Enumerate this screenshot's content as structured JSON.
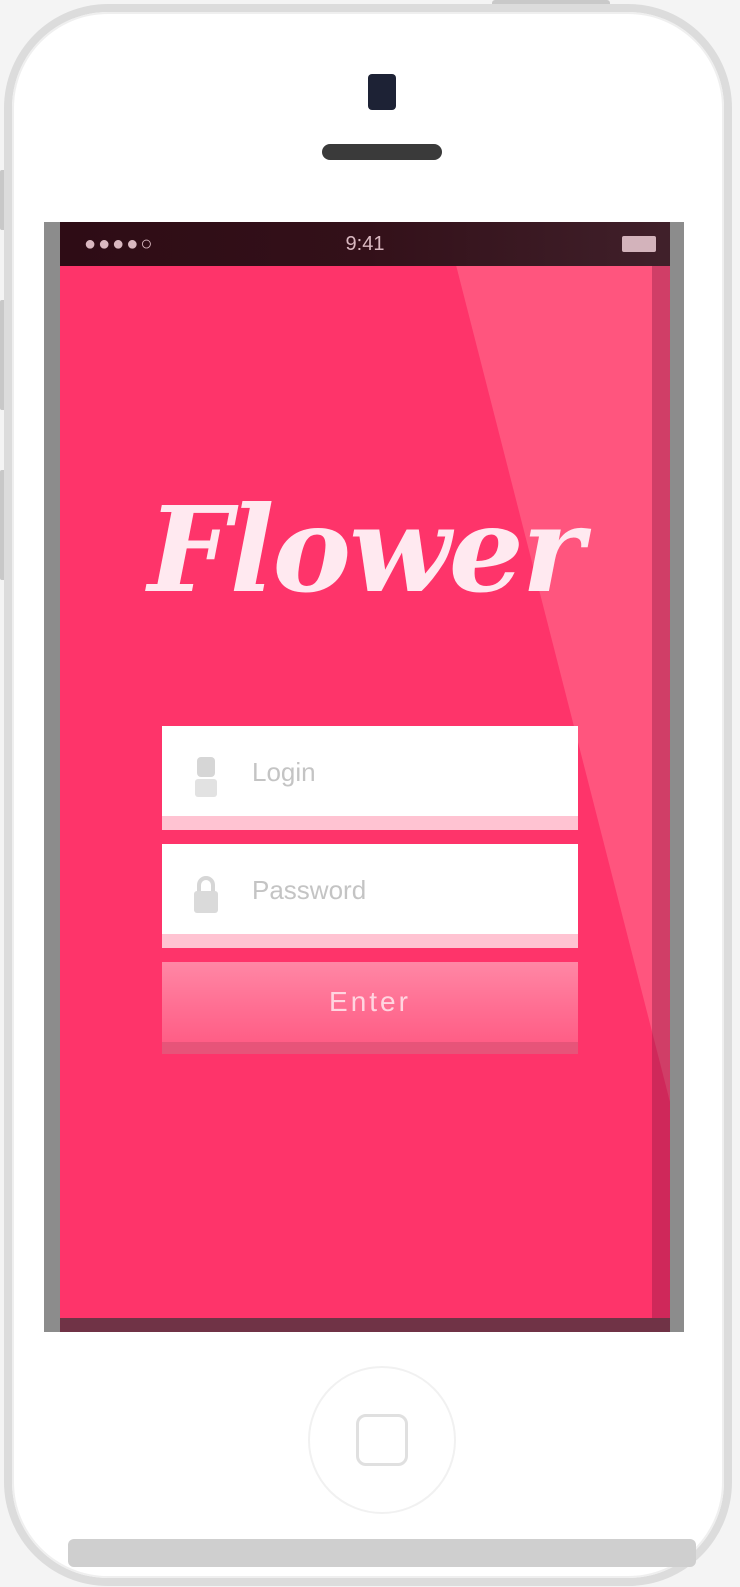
{
  "status_bar": {
    "carrier": "●●●●○",
    "time": "9:41"
  },
  "app": {
    "logo_text": "Flower",
    "accent_color": "#fe346a",
    "highlight_color": "#ff557e"
  },
  "login_form": {
    "login_placeholder": "Login",
    "login_value": "",
    "login_icon": "user-icon",
    "password_placeholder": "Password",
    "password_value": "",
    "password_icon": "lock-icon",
    "submit_label": "Enter"
  },
  "device": {
    "home_button_icon": "home-square-icon"
  }
}
